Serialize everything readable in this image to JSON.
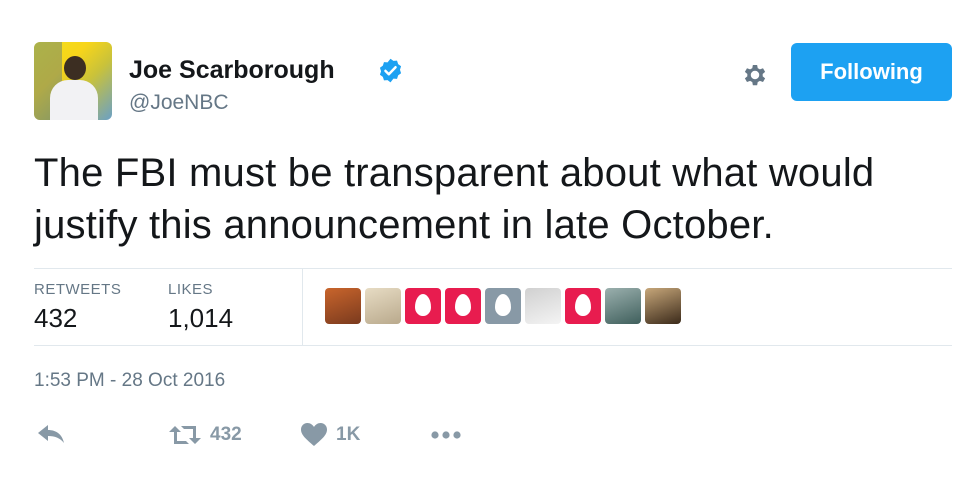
{
  "author": {
    "name": "Joe Scarborough",
    "handle": "@JoeNBC",
    "verified": true
  },
  "follow_button": {
    "label": "Following",
    "color": "#1da1f2"
  },
  "tweet": {
    "text": "The FBI must be transparent about what would justify this announcement in late October.",
    "timestamp": "1:53 PM - 28 Oct 2016"
  },
  "stats": {
    "retweets_label": "RETWEETS",
    "retweets_value": "432",
    "likes_label": "LIKES",
    "likes_value": "1,014"
  },
  "liked_by": [
    {
      "type": "photo",
      "colors": [
        "#7a3a1e",
        "#c9652c"
      ]
    },
    {
      "type": "photo",
      "colors": [
        "#b9a98c",
        "#e7dcc4"
      ]
    },
    {
      "type": "egg",
      "color": "#e81c4f"
    },
    {
      "type": "egg",
      "color": "#e81c4f"
    },
    {
      "type": "egg",
      "color": "#8899a6"
    },
    {
      "type": "photo",
      "colors": [
        "#f4f4f4",
        "#d0d0d0"
      ]
    },
    {
      "type": "egg",
      "color": "#e81c4f"
    },
    {
      "type": "photo",
      "colors": [
        "#3f5f5c",
        "#9bb0ae"
      ]
    },
    {
      "type": "photo",
      "colors": [
        "#3b2a1a",
        "#c7a77a"
      ]
    }
  ],
  "actions": {
    "reply_icon": "reply-icon",
    "retweet_count": "432",
    "like_count": "1K",
    "more_icon": "more-icon"
  },
  "colors": {
    "secondary_text": "#657786",
    "icon_gray": "#8899a6",
    "verified_blue": "#1da1f2"
  }
}
